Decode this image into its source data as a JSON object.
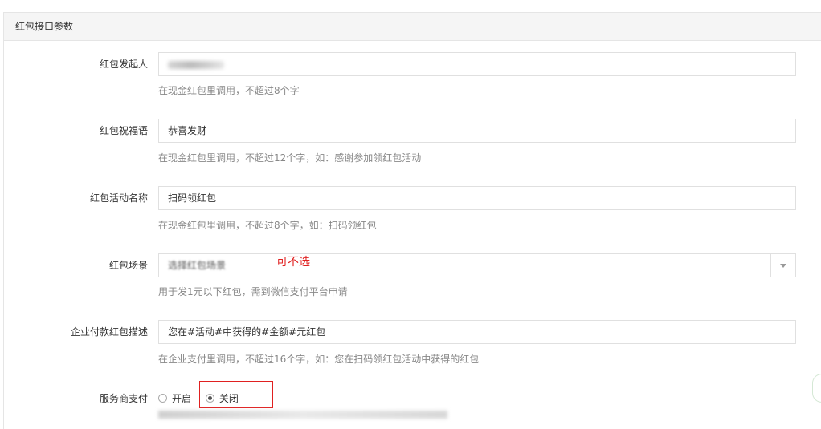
{
  "panel": {
    "title": "红包接口参数"
  },
  "fields": {
    "sender": {
      "label": "红包发起人",
      "value": "",
      "help": "在现金红包里调用，不超过8个字"
    },
    "wishing": {
      "label": "红包祝福语",
      "value": "恭喜发财",
      "help": "在现金红包里调用，不超过12个字，如：感谢参加领红包活动"
    },
    "activity_name": {
      "label": "红包活动名称",
      "value": "扫码领红包",
      "help": "在现金红包里调用，不超过8个字，如：扫码领红包"
    },
    "scene": {
      "label": "红包场景",
      "placeholder": "选择红包场景",
      "help": "用于发1元以下红包，需到微信支付平台申请",
      "annotation": "可不选"
    },
    "enterprise_desc": {
      "label": "企业付款红包描述",
      "value": "您在#活动#中获得的#金额#元红包",
      "help": "在企业支付里调用，不超过16个字，如：您在扫码领红包活动中获得的红包"
    },
    "service_pay": {
      "label": "服务商支付",
      "options": [
        "开启",
        "关闭"
      ],
      "selected": "关闭"
    }
  },
  "colors": {
    "annotation": "#e02020",
    "border": "#e0e0e0",
    "heading_bg": "#f5f5f5"
  }
}
